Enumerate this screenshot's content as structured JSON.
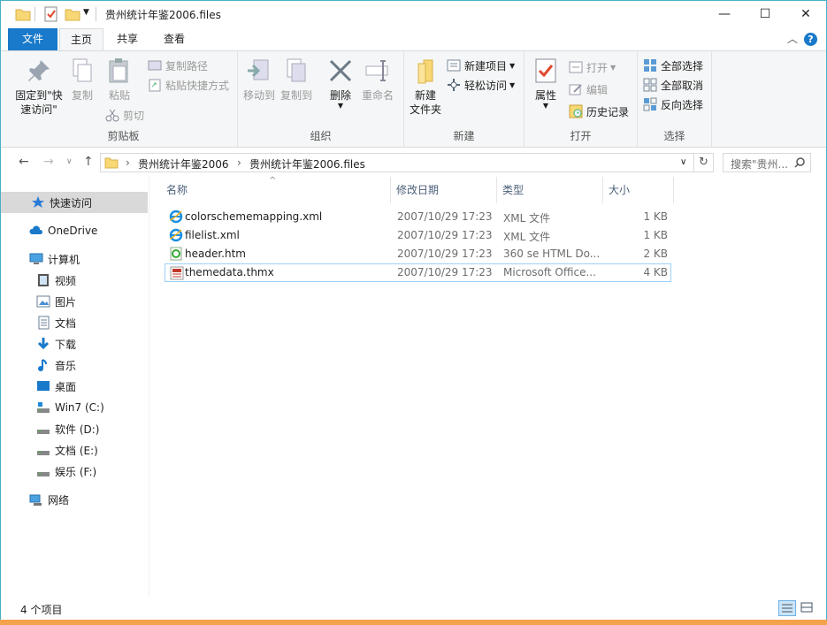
{
  "window": {
    "title": "贵州统计年鉴2006.files",
    "minimize": "—",
    "maximize": "☐",
    "close": "✕"
  },
  "tabs": {
    "file": "文件",
    "home": "主页",
    "share": "共享",
    "view": "查看"
  },
  "ribbon": {
    "clipboard": {
      "label": "剪贴板",
      "pin": "固定到\"快速访问\"",
      "pin_line1": "固定到\"快",
      "pin_line2": "速访问\"",
      "copy": "复制",
      "paste": "粘贴",
      "copy_path": "复制路径",
      "paste_shortcut": "粘贴快捷方式",
      "cut": "剪切"
    },
    "organize": {
      "label": "组织",
      "move_to": "移动到",
      "copy_to": "复制到",
      "delete": "删除",
      "rename": "重命名"
    },
    "new": {
      "label": "新建",
      "new_folder_line1": "新建",
      "new_folder_line2": "文件夹",
      "new_item": "新建项目",
      "easy_access": "轻松访问"
    },
    "open": {
      "label": "打开",
      "properties": "属性",
      "open": "打开",
      "edit": "编辑",
      "history": "历史记录"
    },
    "select": {
      "label": "选择",
      "select_all": "全部选择",
      "select_none": "全部取消",
      "invert": "反向选择"
    }
  },
  "address": {
    "crumbs": [
      "贵州统计年鉴2006",
      "贵州统计年鉴2006.files"
    ],
    "search_placeholder": "搜索\"贵州..."
  },
  "sidebar": {
    "items": [
      {
        "label": "快速访问",
        "icon": "star-icon"
      },
      {
        "label": "OneDrive",
        "icon": "cloud-icon"
      },
      {
        "label": "计算机",
        "icon": "computer-icon"
      },
      {
        "label": "视频",
        "icon": "video-icon"
      },
      {
        "label": "图片",
        "icon": "pictures-icon"
      },
      {
        "label": "文档",
        "icon": "documents-icon"
      },
      {
        "label": "下载",
        "icon": "download-icon"
      },
      {
        "label": "音乐",
        "icon": "music-icon"
      },
      {
        "label": "桌面",
        "icon": "desktop-icon"
      },
      {
        "label": "Win7 (C:)",
        "icon": "drive-icon"
      },
      {
        "label": "软件 (D:)",
        "icon": "drive-icon"
      },
      {
        "label": "文档 (E:)",
        "icon": "drive-icon"
      },
      {
        "label": "娱乐 (F:)",
        "icon": "drive-icon"
      },
      {
        "label": "网络",
        "icon": "network-icon"
      }
    ]
  },
  "columns": {
    "name": "名称",
    "modified": "修改日期",
    "type": "类型",
    "size": "大小"
  },
  "files": [
    {
      "name": "colorschememapping.xml",
      "modified": "2007/10/29 17:23",
      "type": "XML 文件",
      "size": "1 KB",
      "icon": "ie-xml-icon"
    },
    {
      "name": "filelist.xml",
      "modified": "2007/10/29 17:23",
      "type": "XML 文件",
      "size": "1 KB",
      "icon": "ie-xml-icon"
    },
    {
      "name": "header.htm",
      "modified": "2007/10/29 17:23",
      "type": "360 se HTML Do...",
      "size": "2 KB",
      "icon": "html-icon"
    },
    {
      "name": "themedata.thmx",
      "modified": "2007/10/29 17:23",
      "type": "Microsoft Office...",
      "size": "4 KB",
      "icon": "office-theme-icon"
    }
  ],
  "status": {
    "count": "4 个项目"
  },
  "colors": {
    "accent": "#1979ca",
    "selection": "#99d1ff",
    "folder": "#f8d775"
  }
}
